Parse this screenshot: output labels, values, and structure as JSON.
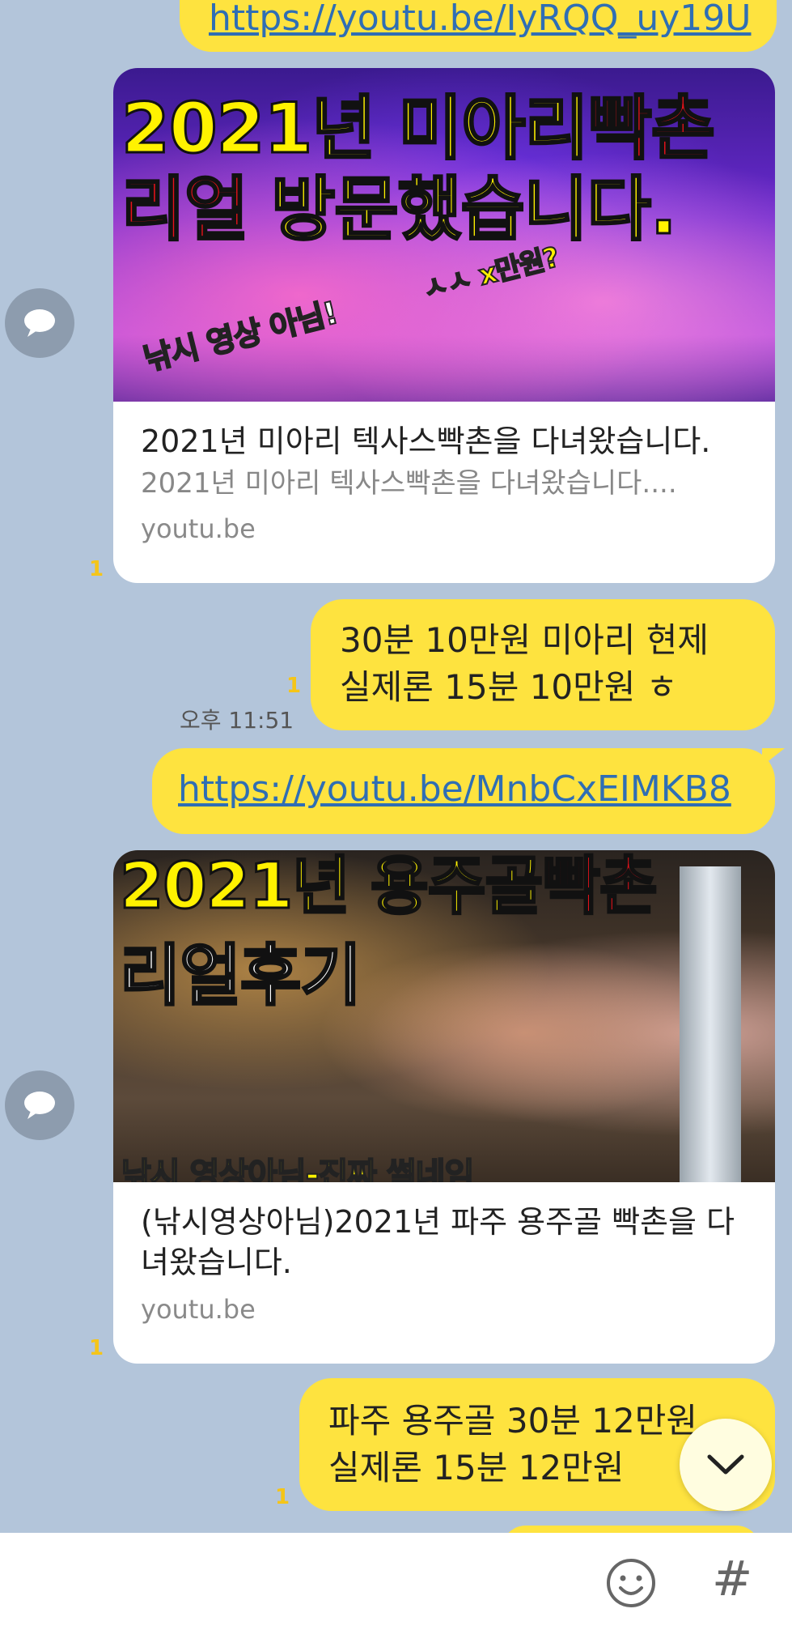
{
  "messages": {
    "link1": "https://youtu.be/IyRQQ_uy19U",
    "card1": {
      "thumb_line1_a": "2021년 미아리",
      "thumb_line1_b": "빡촌",
      "thumb_line2_a": "리얼",
      "thumb_line2_b": "방문했습니다.",
      "thumb_overlay1": "낚시 영상 아님!",
      "thumb_overlay2": "ㅅㅅ x만원?",
      "title": "2021년 미아리 텍사스빡촌을 다녀왔습니다.",
      "description": "2021년 미아리 텍사스빡촌을 다녀왔습니다....",
      "domain": "youtu.be",
      "read_count": "1"
    },
    "text1": {
      "line1": "30분 10만원 미아리 현제",
      "line2": "실제론  15분 10만원 ㅎ",
      "read_count": "1",
      "time": "오후 11:51"
    },
    "link2": "https://youtu.be/MnbCxEIMKB8",
    "card2": {
      "thumb_line1_a": "2021년 용주골",
      "thumb_line1_b": "빡촌",
      "thumb_line2": "리얼후기",
      "thumb_bottom": "낚시 영상아님-진짜 썰네임",
      "title": "(낚시영상아님)2021년 파주 용주골 빡촌을 다녀왔습니다.",
      "domain": "youtu.be",
      "read_count": "1"
    },
    "text2": {
      "line1": "파주 용주골  30분 12만원",
      "line2": "실제론  15분 12만원",
      "read_count": "1"
    }
  },
  "icons": {
    "avatar": "chat-bubble-icon",
    "scroll_down": "chevron-down-icon",
    "emoji": "emoji-icon",
    "hash": "hash-icon"
  },
  "hash_glyph": "#",
  "colors": {
    "background": "#b3c5da",
    "bubble": "#fee33f",
    "link": "#2f6eb4",
    "read_count": "#f5c518"
  }
}
